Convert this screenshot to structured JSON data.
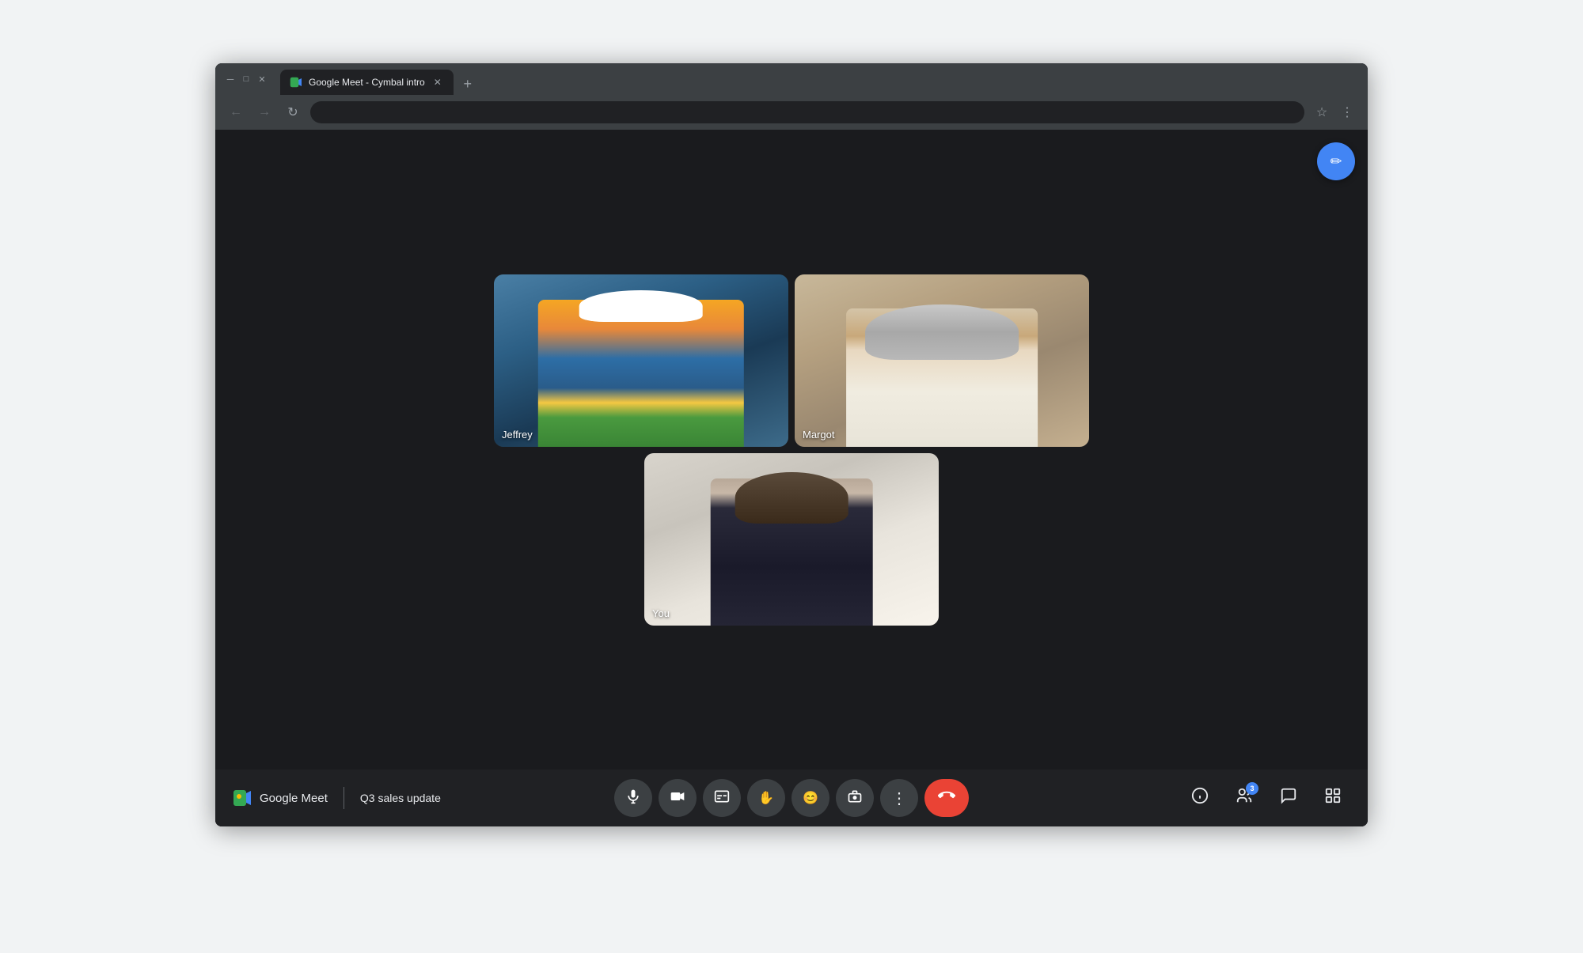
{
  "browser": {
    "tab": {
      "title": "Google Meet - Cymbal intro",
      "favicon_label": "google-meet-favicon"
    },
    "new_tab_label": "+",
    "nav": {
      "back_label": "←",
      "forward_label": "→",
      "reload_label": "↺",
      "address": "",
      "bookmark_label": "☆",
      "menu_label": "⋮"
    },
    "window_controls": {
      "minimize_label": "—",
      "maximize_label": "□",
      "close_label": "✕"
    }
  },
  "meet": {
    "branding": {
      "logo_label": "Google Meet Logo",
      "app_name": "Google Meet",
      "separator": "|",
      "meeting_title": "Q3 sales update"
    },
    "participants": [
      {
        "id": "jeffrey",
        "name": "Jeffrey",
        "position": "top-left"
      },
      {
        "id": "margot",
        "name": "Margot",
        "position": "top-right"
      },
      {
        "id": "you",
        "name": "You",
        "position": "bottom-center"
      }
    ],
    "controls": {
      "mic_label": "🎤",
      "camera_label": "📹",
      "captions_label": "CC",
      "raise_hand_label": "✋",
      "emoji_label": "😊",
      "present_label": "⬆",
      "more_label": "⋮",
      "end_call_label": "📞",
      "info_label": "ⓘ",
      "participants_label": "👥",
      "chat_label": "💬",
      "activities_label": "⚡",
      "participant_count": "3",
      "edit_label": "✏"
    }
  }
}
